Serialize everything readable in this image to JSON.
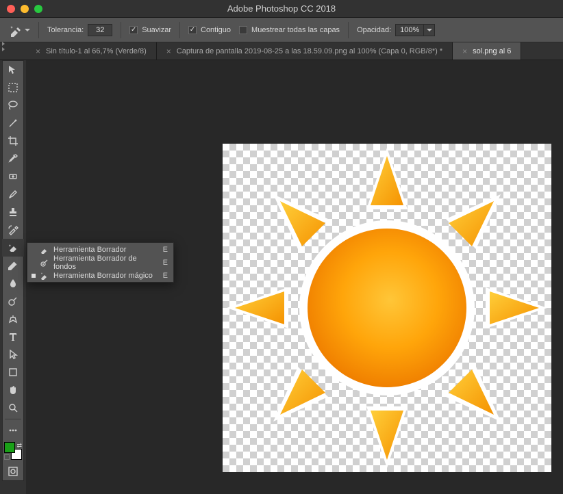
{
  "app_title": "Adobe Photoshop CC 2018",
  "options_bar": {
    "tolerance_label": "Tolerancia:",
    "tolerance_value": "32",
    "suavizar_label": "Suavizar",
    "suavizar_checked": true,
    "contiguo_label": "Contiguo",
    "contiguo_checked": true,
    "muestrear_label": "Muestrear todas las capas",
    "muestrear_checked": false,
    "opacidad_label": "Opacidad:",
    "opacidad_value": "100%"
  },
  "tabs": [
    {
      "label": "Sin título-1 al 66,7% (Verde/8)",
      "active": false
    },
    {
      "label": "Captura de pantalla 2019-08-25 a las 18.59.09.png al 100% (Capa 0, RGB/8*) *",
      "active": false
    },
    {
      "label": "sol.png al 6",
      "active": true
    }
  ],
  "flyout": {
    "items": [
      {
        "label": "Herramienta Borrador",
        "shortcut": "E",
        "selected": false,
        "icon": "eraser-icon"
      },
      {
        "label": "Herramienta Borrador de fondos",
        "shortcut": "E",
        "selected": false,
        "icon": "bg-eraser-icon"
      },
      {
        "label": "Herramienta Borrador mágico",
        "shortcut": "E",
        "selected": true,
        "icon": "magic-eraser-icon"
      }
    ]
  },
  "colors": {
    "foreground": "#1aa018",
    "background": "#ffffff"
  },
  "tool_names": [
    "move-tool",
    "marquee-tool",
    "lasso-tool",
    "magic-wand-tool",
    "crop-tool",
    "eyedropper-tool",
    "healing-brush-tool",
    "brush-tool",
    "stamp-tool",
    "history-brush-tool",
    "eraser-tool",
    "gradient-tool",
    "blur-tool",
    "dodge-tool",
    "pen-tool",
    "type-tool",
    "path-select-tool",
    "shape-tool",
    "hand-tool",
    "zoom-tool"
  ]
}
